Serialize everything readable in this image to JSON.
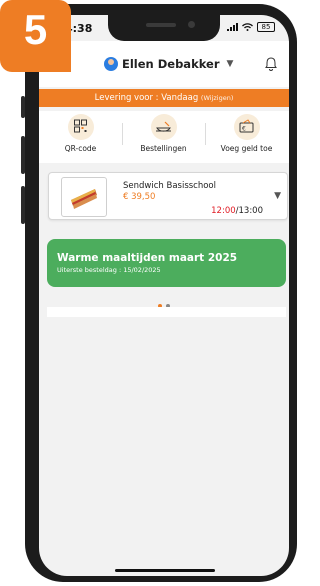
{
  "step_badge": "5",
  "status_bar": {
    "time": "4:38",
    "battery": "85"
  },
  "header": {
    "user_name": "Ellen Debakker"
  },
  "delivery_bar": {
    "text": "Levering voor : Vandaag",
    "change_label": "(Wijzigen)"
  },
  "shortcuts": [
    {
      "label": "QR-code",
      "icon": "qr-icon"
    },
    {
      "label": "Bestellingen",
      "icon": "order-bowl-icon"
    },
    {
      "label": "Voeg geld toe",
      "icon": "wallet-icon"
    }
  ],
  "order": {
    "title": "Sendwich Basisschool",
    "price": "€ 39,50",
    "time_start": "12:00",
    "time_end": "/13:00"
  },
  "promo": {
    "title": "Warme maaltijden maart 2025",
    "subtitle": "Uiterste besteldag : 15/02/2025"
  },
  "colors": {
    "accent": "#ee7d24",
    "promo": "#4cad5d",
    "time_red": "#e01b24"
  }
}
